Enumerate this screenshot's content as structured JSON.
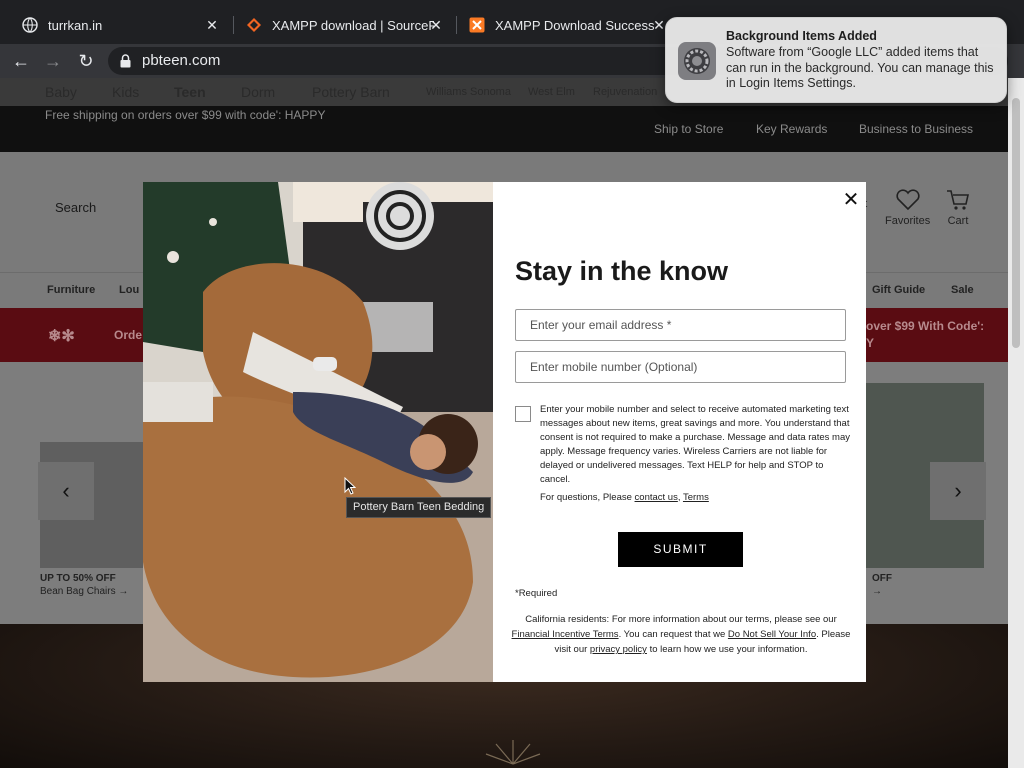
{
  "browser": {
    "tabs": [
      {
        "label": "turrkan.in",
        "icon": "globe-icon"
      },
      {
        "label": "XAMPP download | SourceF",
        "icon": "sourceforge-icon"
      },
      {
        "label": "XAMPP Download Success",
        "icon": "xampp-icon"
      }
    ],
    "url": "pbteen.com"
  },
  "site": {
    "brands": [
      "Baby",
      "Kids",
      "Teen",
      "Dorm",
      "Pottery Barn",
      "Williams Sonoma",
      "West Elm",
      "Rejuvenation"
    ],
    "promo": "Free shipping on orders over $99 with code': HAPPY",
    "top_links": [
      "Ship to Store",
      "Key Rewards",
      "Business to Business"
    ],
    "search_label": "Search",
    "header_icons": [
      {
        "label": "nt",
        "icon": "account-icon"
      },
      {
        "label": "Favorites",
        "icon": "heart-icon"
      },
      {
        "label": "Cart",
        "icon": "cart-icon"
      }
    ],
    "categories": [
      "Furniture",
      "Lou",
      "Gift Guide",
      "Sale"
    ],
    "red_banner": {
      "left": "Orde",
      "right_line1": "over $99 With Code':",
      "right_line2": "Y"
    },
    "carousel": {
      "left_caption": "UP TO 50% OFF",
      "left_sub": "Bean Bag Chairs →",
      "right_caption": "OFF",
      "right_sub": "→"
    }
  },
  "modal": {
    "title": "Stay in the know",
    "email_placeholder": "Enter your email address *",
    "phone_placeholder": "Enter mobile number (Optional)",
    "consent_text": "Enter your mobile number and select to receive automated marketing text messages about new items, great savings and more. You understand that consent is not required to make a purchase. Message and data rates may apply. Message frequency varies. Wireless Carriers are not liable for delayed or undelivered messages. Text HELP for help and STOP to cancel.",
    "questions_prefix": "For questions, Please ",
    "contact_link": "contact us",
    "comma": ", ",
    "terms_link": "Terms",
    "submit_label": "SUBMIT",
    "required_note": "*Required",
    "legal_1": "California residents: For more information about our terms, please see our ",
    "legal_link_1": "Financial Incentive Terms",
    "legal_2": ". You can request that we ",
    "legal_link_2": "Do Not Sell Your Info",
    "legal_3": ". Please visit our ",
    "legal_link_3": "privacy policy",
    "legal_4": " to learn how we use your information."
  },
  "tooltip": "Pottery Barn Teen Bedding",
  "notification": {
    "title": "Background Items Added",
    "body": "Software from “Google LLC” added items that can run in the background. You can manage this in Login Items Settings."
  }
}
